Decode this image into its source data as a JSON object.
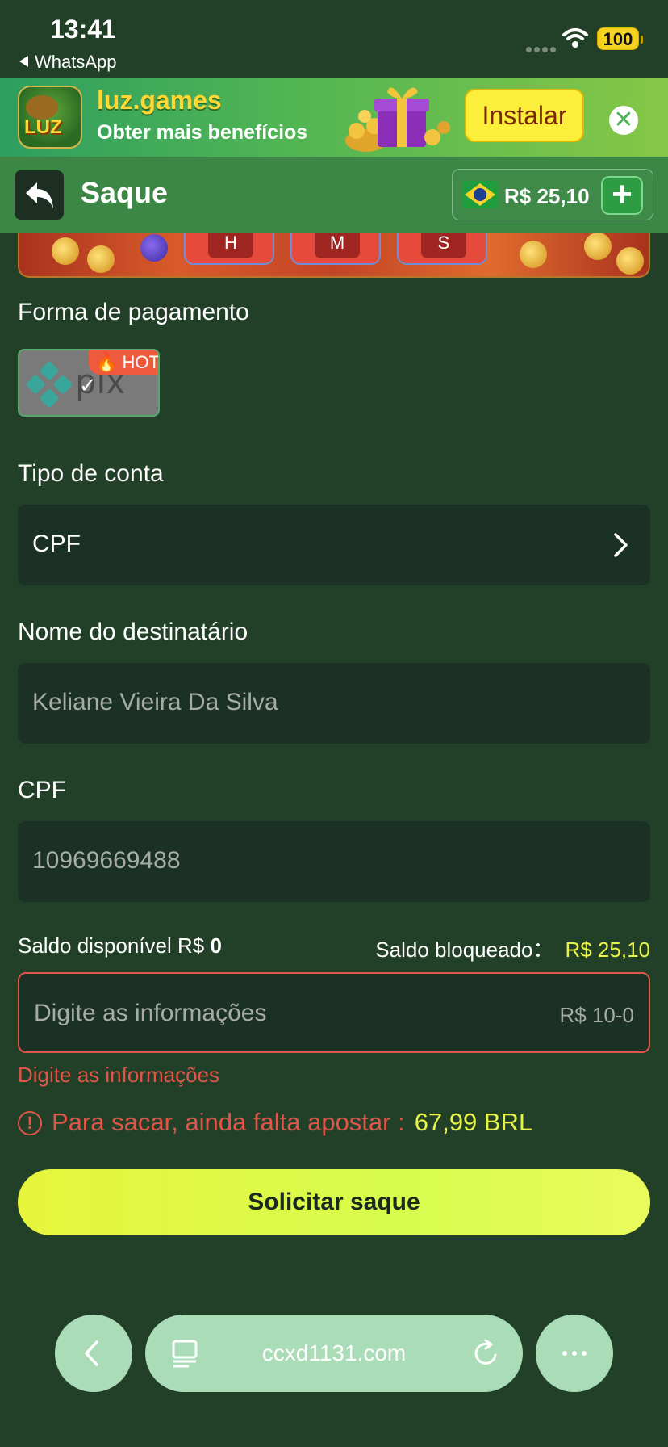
{
  "status": {
    "time": "13:41",
    "back_app": "WhatsApp",
    "battery": "100"
  },
  "banner": {
    "title": "luz.games",
    "subtitle": "Obter mais benefícios",
    "install_label": "Instalar",
    "close_glyph": "✕"
  },
  "header": {
    "title": "Saque",
    "balance": "R$ 25,10",
    "plus_glyph": "+"
  },
  "promo": {
    "keys": [
      "H",
      "M",
      "S"
    ]
  },
  "form": {
    "payment_label": "Forma de pagamento",
    "payment_method": "pix",
    "hot_tag": "HOT",
    "account_type_label": "Tipo de conta",
    "account_type_value": "CPF",
    "recipient_label": "Nome do destinatário",
    "recipient_value": "Keliane Vieira Da Silva",
    "cpf_label": "CPF",
    "cpf_value": "10969669488",
    "available_label": "Saldo disponível R$",
    "available_value": "0",
    "blocked_label": "Saldo bloqueado：",
    "blocked_value": "R$ 25,10",
    "amount_placeholder": "Digite as informações",
    "amount_range": "R$ 10-0",
    "error_text": "Digite as informações",
    "warning_icon": "!",
    "warning_text": "Para sacar, ainda falta apostar :",
    "warning_value": "67,99 BRL",
    "submit_label": "Solicitar saque"
  },
  "browser": {
    "url": "ccxd1131.com"
  },
  "colors": {
    "background": "#223f27",
    "header": "#3c8745",
    "accent_yellow": "#e9f545",
    "error_red": "#e0574a",
    "button": "#e6f53b"
  },
  "icons": [
    "back-arrow-icon",
    "brazil-flag-icon",
    "plus-icon",
    "chevron-right-icon",
    "alert-icon",
    "close-icon",
    "page-icon",
    "reload-icon",
    "more-icon"
  ]
}
